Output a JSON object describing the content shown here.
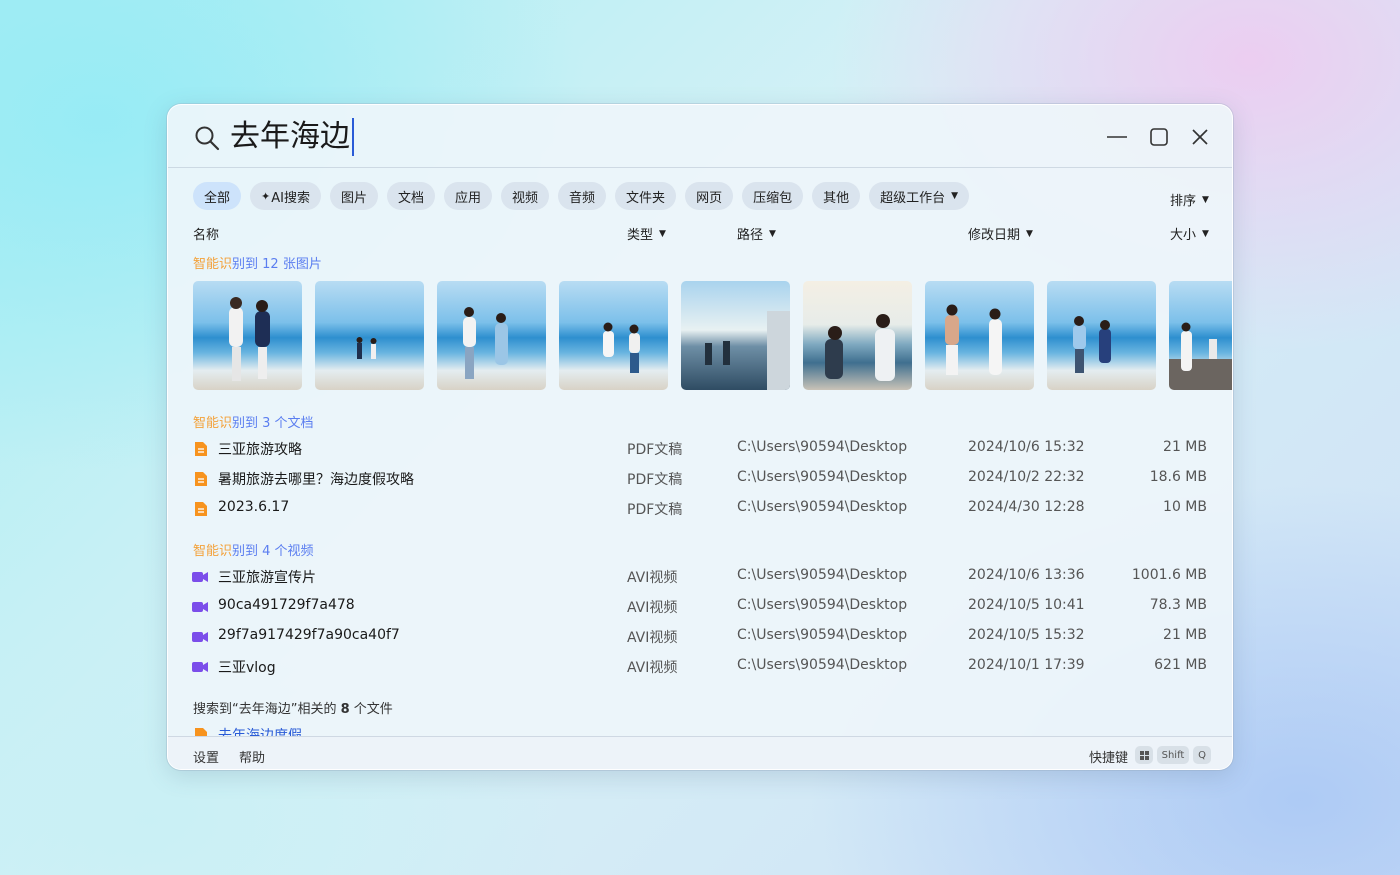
{
  "search": {
    "query": "去年海边"
  },
  "filters": [
    {
      "label": "全部",
      "active": true
    },
    {
      "label": "AI搜索",
      "spark": true
    },
    {
      "label": "图片"
    },
    {
      "label": "文档"
    },
    {
      "label": "应用"
    },
    {
      "label": "视频"
    },
    {
      "label": "音频"
    },
    {
      "label": "文件夹"
    },
    {
      "label": "网页"
    },
    {
      "label": "压缩包"
    },
    {
      "label": "其他"
    },
    {
      "label": "超级工作台",
      "dropdown": true
    }
  ],
  "sort_label": "排序",
  "columns": {
    "name": "名称",
    "type": "类型",
    "path": "路径",
    "date": "修改日期",
    "size": "大小"
  },
  "images_section": {
    "prefix_a": "智能识",
    "prefix_b": "别到 12 张图片"
  },
  "docs_section": {
    "prefix_a": "智能识",
    "prefix_b": "别到 3 个文档"
  },
  "videos_section": {
    "prefix_a": "智能识",
    "prefix_b": "别到 4 个视频"
  },
  "documents": [
    {
      "name": "三亚旅游攻略",
      "type": "PDF文稿",
      "path": "C:\\Users\\90594\\Desktop",
      "date": "2024/10/6  15:32",
      "size": "21 MB"
    },
    {
      "name": "暑期旅游去哪里？海边度假攻略",
      "type": "PDF文稿",
      "path": "C:\\Users\\90594\\Desktop",
      "date": "2024/10/2  22:32",
      "size": "18.6 MB"
    },
    {
      "name": "2023.6.17",
      "type": "PDF文稿",
      "path": "C:\\Users\\90594\\Desktop",
      "date": "2024/4/30  12:28",
      "size": "10 MB"
    }
  ],
  "videos": [
    {
      "name": "三亚旅游宣传片",
      "type": "AVI视频",
      "path": "C:\\Users\\90594\\Desktop",
      "date": "2024/10/6  13:36",
      "size": "1001.6 MB"
    },
    {
      "name": "90ca491729f7a478",
      "type": "AVI视频",
      "path": "C:\\Users\\90594\\Desktop",
      "date": "2024/10/5  10:41",
      "size": "78.3 MB"
    },
    {
      "name": "29f7a917429f7a90ca40f7",
      "type": "AVI视频",
      "path": "C:\\Users\\90594\\Desktop",
      "date": "2024/10/5  15:32",
      "size": "21 MB"
    },
    {
      "name": "三亚vlog",
      "type": "AVI视频",
      "path": "C:\\Users\\90594\\Desktop",
      "date": "2024/10/1  17:39",
      "size": "621 MB"
    }
  ],
  "related": {
    "text_a": "搜索到“去年海边”相关的 ",
    "count": "8",
    "text_b": " 个文件",
    "partial_item": "去年海边度假"
  },
  "footer": {
    "settings": "设置",
    "help": "帮助",
    "shortcut_label": "快捷键",
    "key_shift": "Shift",
    "key_q": "Q"
  },
  "colors": {
    "accent": "#2a5bd7",
    "doc_icon": "#f7931e",
    "video_icon": "#7b4dea",
    "ai_orange": "#f3a23b",
    "ai_blue": "#5b7ef0"
  }
}
